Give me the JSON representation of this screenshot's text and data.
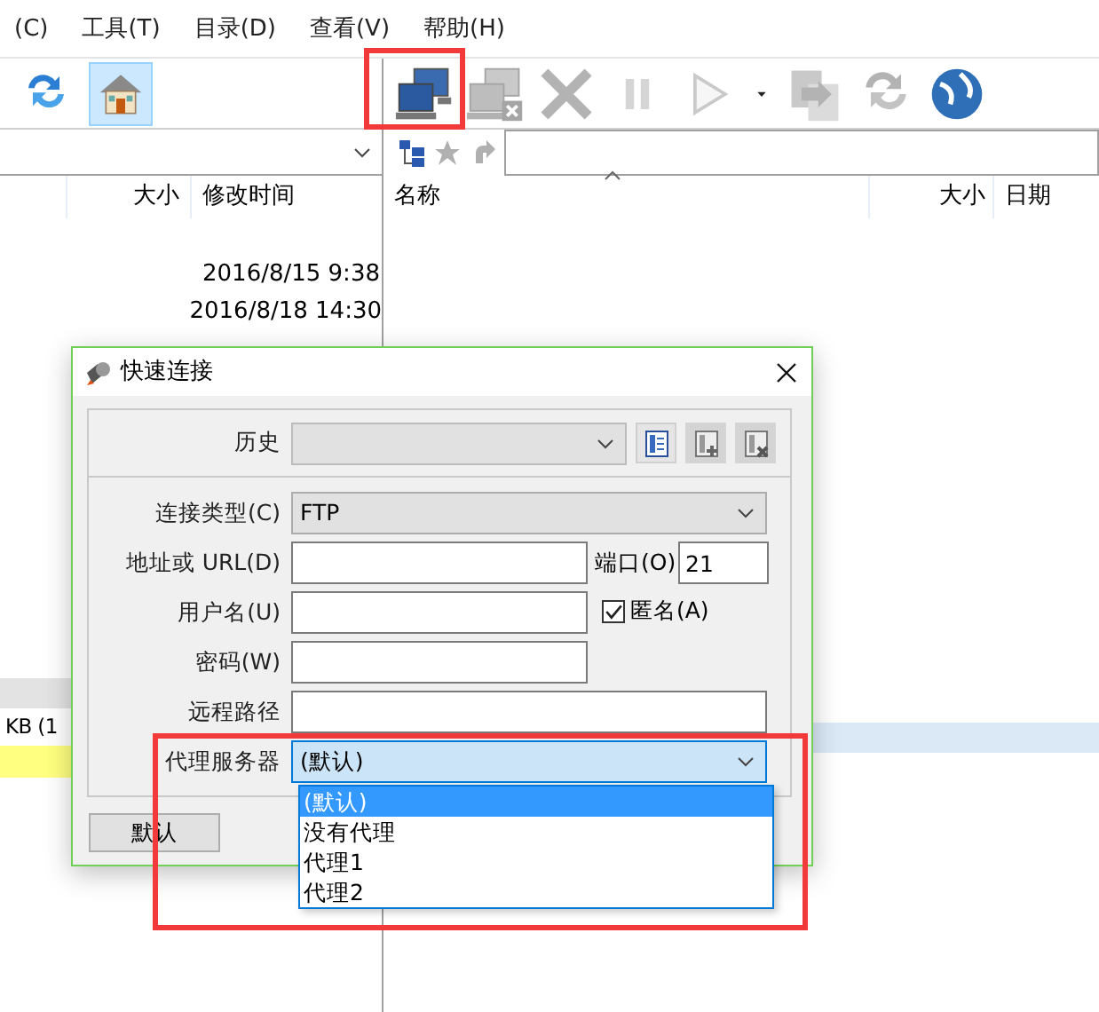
{
  "menu": [
    {
      "label": "(C)"
    },
    {
      "label": "工具(T)"
    },
    {
      "label": "目录(D)"
    },
    {
      "label": "查看(V)"
    },
    {
      "label": "帮助(H)"
    }
  ],
  "local_toolbar": [
    {
      "kind": "refresh",
      "selected": false
    },
    {
      "kind": "home",
      "selected": true
    }
  ],
  "remote_toolbar": [
    {
      "kind": "connect",
      "disabled": false
    },
    {
      "kind": "disconnect",
      "disabled": true
    },
    {
      "kind": "cancel",
      "disabled": true
    },
    {
      "kind": "pause",
      "disabled": true
    },
    {
      "kind": "play",
      "disabled": true
    },
    {
      "kind": "dropdown",
      "disabled": false
    },
    {
      "kind": "transfer",
      "disabled": true
    },
    {
      "kind": "refresh",
      "disabled": true
    },
    {
      "kind": "globe",
      "disabled": false
    }
  ],
  "local_panel": {
    "columns": [
      "大小",
      "修改时间"
    ],
    "rows": [
      {
        "modified": "2016/8/15 9:38"
      },
      {
        "modified": "2016/8/18 14:30"
      }
    ],
    "status_text": "KB (1"
  },
  "remote_panel": {
    "columns": [
      "名称",
      "大小",
      "日期"
    ]
  },
  "dialog": {
    "title": "快速连接",
    "history": {
      "label": "历史"
    },
    "fields": [
      {
        "kind": "combo",
        "label": "连接类型(C)",
        "value": "FTP"
      },
      {
        "kind": "input",
        "label": "地址或 URL(D)",
        "extra": {
          "kind": "port",
          "label": "端口(O)",
          "value": "21"
        }
      },
      {
        "kind": "input",
        "label": "用户名(U)",
        "extra": {
          "kind": "checkbox",
          "label": "匿名(A)",
          "checked": true
        }
      },
      {
        "kind": "input",
        "label": "密码(W)"
      },
      {
        "kind": "wide",
        "label": "远程路径"
      },
      {
        "kind": "combo",
        "label": "代理服务器",
        "value": "(默认)",
        "focused": true
      }
    ],
    "proxy_options": [
      {
        "label": "(默认)",
        "selected": true
      },
      {
        "label": "没有代理",
        "selected": false
      },
      {
        "label": "代理1",
        "selected": false
      },
      {
        "label": "代理2",
        "selected": false
      }
    ],
    "buttons": [
      {
        "label": "默认"
      }
    ]
  }
}
